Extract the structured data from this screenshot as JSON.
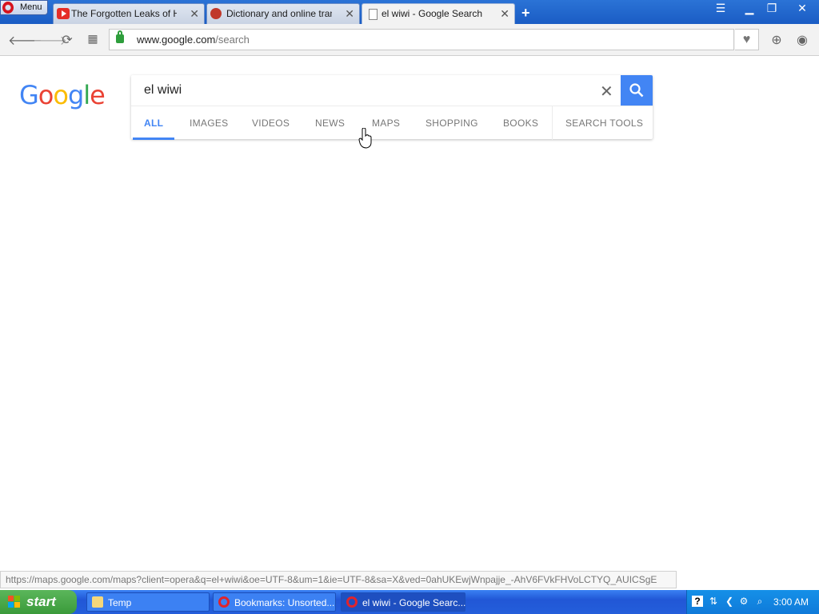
{
  "browser": {
    "menu_label": "Menu",
    "tabs": [
      {
        "title": "The Forgotten Leaks of Half",
        "icon": "youtube-icon",
        "active": false
      },
      {
        "title": "Dictionary and online translat",
        "icon": "dictionary-icon",
        "active": false
      },
      {
        "title": "el wiwi - Google Search",
        "icon": "page-icon",
        "active": true
      }
    ],
    "newtab_symbol": "+",
    "url_domain": "www.google.com",
    "url_path": "/search"
  },
  "google": {
    "logo": [
      "G",
      "o",
      "o",
      "g",
      "l",
      "e"
    ],
    "query": "el wiwi",
    "search_tabs": [
      "ALL",
      "IMAGES",
      "VIDEOS",
      "NEWS",
      "MAPS",
      "SHOPPING",
      "BOOKS",
      "SEARCH TOOLS"
    ],
    "active_tab": "ALL"
  },
  "status_url": "https://maps.google.com/maps?client=opera&q=el+wiwi&oe=UTF-8&um=1&ie=UTF-8&sa=X&ved=0ahUKEwjWnpajje_-AhV6FVkFHVoLCTYQ_AUICSgE",
  "taskbar": {
    "start_label": "start",
    "tasks": [
      {
        "label": "Temp",
        "icon": "folder-icon"
      },
      {
        "label": "Bookmarks: Unsorted...",
        "icon": "opera-icon"
      },
      {
        "label": "el wiwi - Google Searc...",
        "icon": "opera-icon"
      }
    ],
    "clock": "3:00 AM"
  },
  "colors": {
    "accent": "#4285f4",
    "titlebar": "#1a5cc4",
    "taskbar": "#245edb"
  }
}
